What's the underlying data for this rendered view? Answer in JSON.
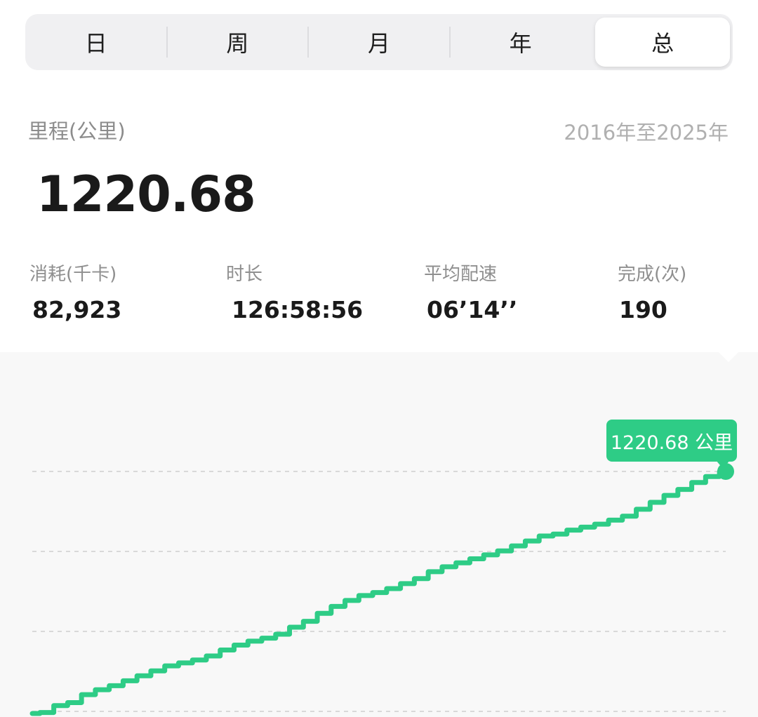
{
  "tabs": [
    {
      "label": "日",
      "active": false
    },
    {
      "label": "周",
      "active": false
    },
    {
      "label": "月",
      "active": false
    },
    {
      "label": "年",
      "active": false
    },
    {
      "label": "总",
      "active": true
    }
  ],
  "summary": {
    "metric_label": "里程(公里)",
    "range_label": "2016年至2025年",
    "value": "1220.68"
  },
  "stats": [
    {
      "label": "消耗(千卡)",
      "value": "82,923"
    },
    {
      "label": "时长",
      "value": "126:58:56"
    },
    {
      "label": "平均配速",
      "value": "06’14’’"
    },
    {
      "label": "完成(次)",
      "value": "190"
    }
  ],
  "tooltip": {
    "text": "1220.68 公里"
  },
  "colors": {
    "accent": "#2ecc86",
    "grid": "#d9d9d9",
    "chart_bg": "#f8f8f8"
  },
  "chart_data": {
    "type": "line",
    "x": [
      0,
      1,
      2,
      3,
      4,
      5,
      6,
      7,
      8,
      9,
      10,
      11,
      12,
      13,
      14,
      15,
      16,
      17,
      18,
      19,
      20,
      21,
      22,
      23,
      24,
      25,
      26,
      27,
      28,
      29,
      30,
      31,
      32,
      33,
      34,
      35,
      36,
      37,
      38,
      39,
      40,
      41,
      42,
      43,
      44,
      45,
      46,
      47,
      48,
      49,
      50
    ],
    "values": [
      0,
      5,
      40,
      55,
      95,
      120,
      140,
      165,
      190,
      215,
      240,
      255,
      270,
      290,
      320,
      345,
      365,
      380,
      400,
      435,
      465,
      505,
      540,
      570,
      595,
      610,
      630,
      655,
      680,
      715,
      740,
      760,
      780,
      800,
      820,
      845,
      870,
      895,
      905,
      925,
      940,
      955,
      975,
      995,
      1030,
      1065,
      1100,
      1130,
      1165,
      1195,
      1220.68
    ],
    "gridlines": 4,
    "title": "",
    "xlabel": "",
    "ylabel": ""
  }
}
